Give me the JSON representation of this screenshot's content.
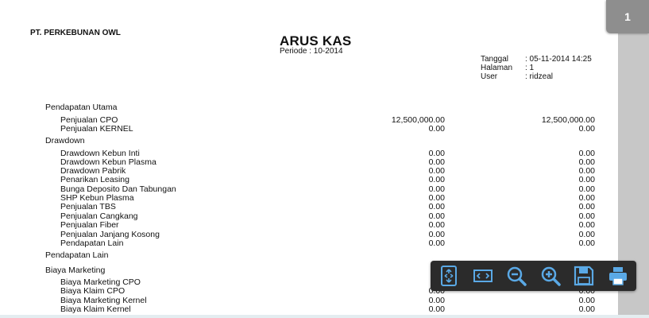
{
  "viewer": {
    "page_badge": "1"
  },
  "report": {
    "company": "PT. PERKEBUNAN OWL",
    "title": "ARUS KAS",
    "periode": "Periode : 10-2014",
    "meta": [
      {
        "label": "Tanggal",
        "value": ": 05-11-2014 14:25"
      },
      {
        "label": "Halaman",
        "value": ": 1"
      },
      {
        "label": "User",
        "value": ": ridzeal"
      }
    ],
    "rows": [
      {
        "type": "header",
        "label": "Pendapatan Utama"
      },
      {
        "type": "item",
        "label": "Penjualan CPO",
        "v1": "12,500,000.00",
        "v2": "12,500,000.00"
      },
      {
        "type": "item",
        "label": "Penjualan KERNEL",
        "v1": "0.00",
        "v2": "0.00"
      },
      {
        "type": "header",
        "label": "Drawdown"
      },
      {
        "type": "item",
        "label": "Drawdown Kebun Inti",
        "v1": "0.00",
        "v2": "0.00"
      },
      {
        "type": "item",
        "label": "Drawdown Kebun Plasma",
        "v1": "0.00",
        "v2": "0.00"
      },
      {
        "type": "item",
        "label": "Drawdown Pabrik",
        "v1": "0.00",
        "v2": "0.00"
      },
      {
        "type": "item",
        "label": "Penarikan Leasing",
        "v1": "0.00",
        "v2": "0.00"
      },
      {
        "type": "item",
        "label": "Bunga Deposito Dan Tabungan",
        "v1": "0.00",
        "v2": "0.00"
      },
      {
        "type": "item",
        "label": "SHP Kebun Plasma",
        "v1": "0.00",
        "v2": "0.00"
      },
      {
        "type": "item",
        "label": "Penjualan TBS",
        "v1": "0.00",
        "v2": "0.00"
      },
      {
        "type": "item",
        "label": "Penjualan Cangkang",
        "v1": "0.00",
        "v2": "0.00"
      },
      {
        "type": "item",
        "label": "Penjualan Fiber",
        "v1": "0.00",
        "v2": "0.00"
      },
      {
        "type": "item",
        "label": "Penjualan Janjang Kosong",
        "v1": "0.00",
        "v2": "0.00"
      },
      {
        "type": "item",
        "label": "Pendapatan Lain",
        "v1": "0.00",
        "v2": "0.00"
      },
      {
        "type": "header",
        "label": "Pendapatan Lain"
      },
      {
        "type": "header",
        "label": "Biaya Marketing"
      },
      {
        "type": "item",
        "label": "Biaya Marketing CPO",
        "v1": "",
        "v2": ""
      },
      {
        "type": "item",
        "label": "Biaya Klaim CPO",
        "v1": "0.00",
        "v2": "0.00"
      },
      {
        "type": "item",
        "label": "Biaya Marketing Kernel",
        "v1": "0.00",
        "v2": "0.00"
      },
      {
        "type": "item",
        "label": "Biaya Klaim Kernel",
        "v1": "0.00",
        "v2": "0.00"
      }
    ]
  },
  "toolbar": {
    "buttons": [
      {
        "name": "fit-page-button",
        "icon": "fit-page-icon"
      },
      {
        "name": "fit-width-button",
        "icon": "fit-width-icon"
      },
      {
        "name": "zoom-out-button",
        "icon": "zoom-out-icon"
      },
      {
        "name": "zoom-in-button",
        "icon": "zoom-in-icon"
      },
      {
        "name": "save-button",
        "icon": "save-icon"
      },
      {
        "name": "print-button",
        "icon": "print-icon"
      }
    ],
    "icon_color": "#5aa9e6"
  }
}
